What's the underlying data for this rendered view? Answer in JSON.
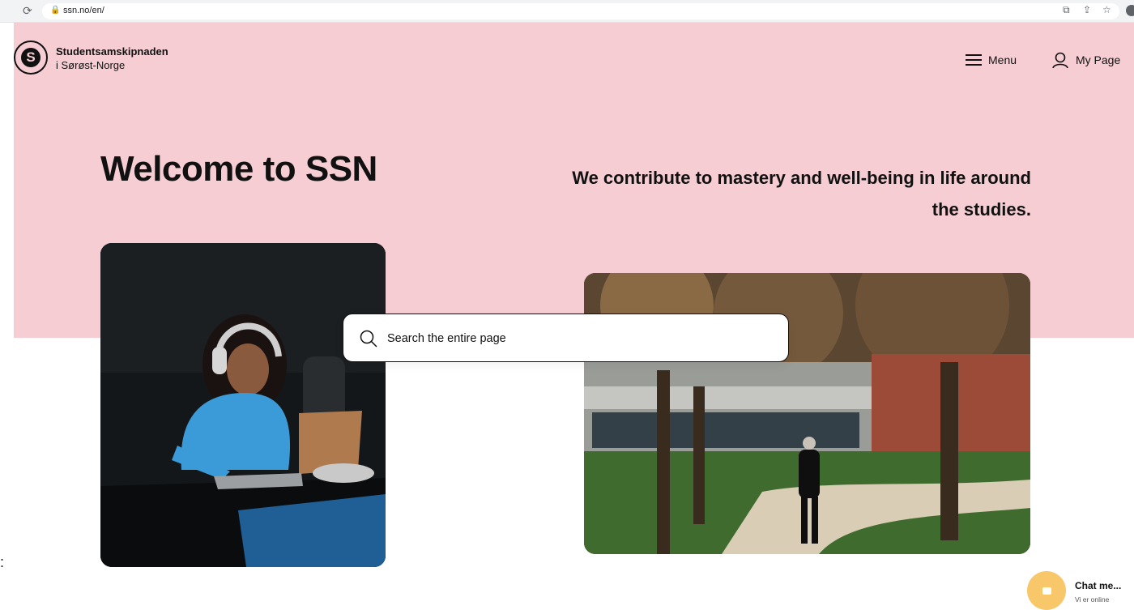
{
  "browser": {
    "url": "ssn.no/en/"
  },
  "header": {
    "brand_line1": "Studentsamskipnaden",
    "brand_line2": "i Sørøst-Norge",
    "logo_letter": "S",
    "menu_label": "Menu",
    "mypage_label": "My Page"
  },
  "hero": {
    "title": "Welcome to SSN",
    "subtitle": "We contribute to mastery and well-being in life around the studies.",
    "background_color": "#f5cdd3"
  },
  "search": {
    "placeholder": "Search the entire page"
  },
  "chat": {
    "title": "Chat me...",
    "status": "Vi er online",
    "accent": "#f7c76a"
  },
  "stray_text": ":"
}
